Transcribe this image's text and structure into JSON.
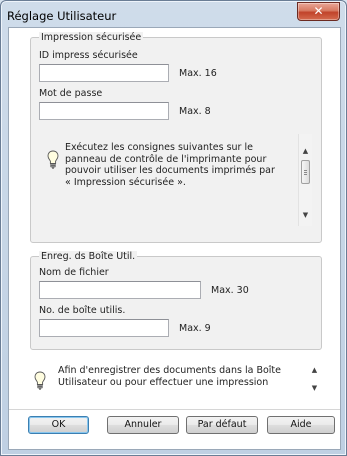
{
  "window": {
    "title": "Réglage Utilisateur",
    "close_glyph": "✕"
  },
  "secure_print": {
    "legend": "Impression sécurisée",
    "id_label": "ID impress sécurisée",
    "id_value": "",
    "id_max": "Max. 16",
    "password_label": "Mot de passe",
    "password_value": "",
    "password_max": "Max. 8",
    "info_text": "Exécutez les consignes suivantes sur le panneau de contrôle de l'imprimante pour pouvoir utiliser les documents imprimés par « Impression sécurisée »."
  },
  "user_box": {
    "legend": "Enreg. ds Boîte Util.",
    "filename_label": "Nom de fichier",
    "filename_value": "",
    "filename_max": "Max. 30",
    "box_number_label": "No. de boîte utilis.",
    "box_number_value": "",
    "box_number_max": "Max. 9"
  },
  "bottom_info": {
    "text": "Afin d'enregistrer des documents dans la Boîte Utilisateur ou pour effectuer une impression"
  },
  "buttons": {
    "ok": "OK",
    "cancel": "Annuler",
    "default": "Par défaut",
    "help": "Aide"
  },
  "icons": {
    "close": "close-icon",
    "info": "lightbulb-icon",
    "scroll_up": "scroll-up-arrow-icon",
    "scroll_down": "scroll-down-arrow-icon"
  }
}
